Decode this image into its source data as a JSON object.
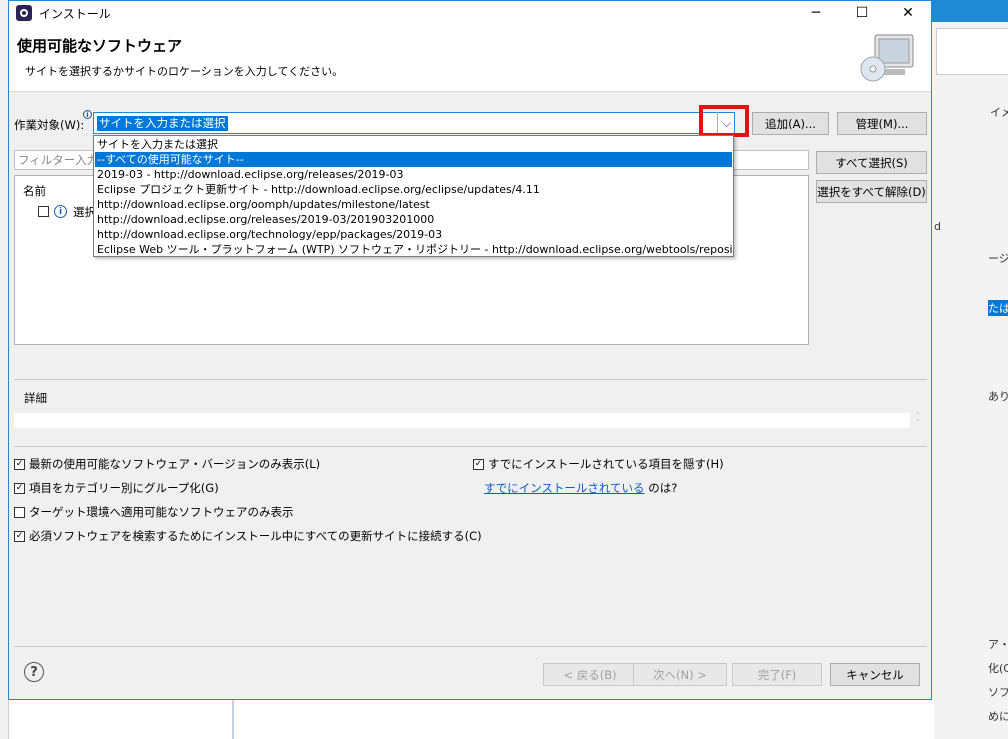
{
  "window": {
    "title": "インストール",
    "minimize": "─",
    "maximize": "☐",
    "close": "✕"
  },
  "header": {
    "title": "使用可能なソフトウェア",
    "description": "サイトを選択するかサイトのロケーションを入力してください。"
  },
  "work_with": {
    "label": "作業対象(W):",
    "value": "サイトを入力または選択",
    "add_button": "追加(A)...",
    "manage_button": "管理(M)..."
  },
  "dropdown": {
    "items": [
      "サイトを入力または選択",
      "--すべての使用可能なサイト--",
      "2019-03 - http://download.eclipse.org/releases/2019-03",
      "Eclipse プロジェクト更新サイト - http://download.eclipse.org/eclipse/updates/4.11",
      "http://download.eclipse.org/oomph/updates/milestone/latest",
      "http://download.eclipse.org/releases/2019-03/201903201000",
      "http://download.eclipse.org/technology/epp/packages/2019-03",
      "Eclipse Web ツール・プラットフォーム (WTP) ソフトウェア・リポジトリー - http://download.eclipse.org/webtools/repository/latest"
    ],
    "selected_index": 1
  },
  "filter": {
    "placeholder": "フィルター入力"
  },
  "tree": {
    "column": "名前",
    "row_text": "選択"
  },
  "side_buttons": {
    "select_all": "すべて選択(S)",
    "deselect_all": "選択をすべて解除(D)"
  },
  "details": {
    "label": "詳細"
  },
  "options": {
    "latest_only": "最新の使用可能なソフトウェア・バージョンのみ表示(L)",
    "group_by_category": "項目をカテゴリー別にグループ化(G)",
    "target_env_only": "ターゲット環境へ適用可能なソフトウェアのみ表示",
    "contact_all_sites": "必須ソフトウェアを検索するためにインストール中にすべての更新サイトに接続する(C)",
    "hide_installed": "すでにインストールされている項目を隠す(H)",
    "installed_link": "すでにインストールされている",
    "installed_suffix": " のは?"
  },
  "footer": {
    "back": "< 戻る(B)",
    "next": "次へ(N) >",
    "finish": "完了(F)",
    "cancel": "キャンセル"
  },
  "background": {
    "r1": "イメ",
    "r2": "d",
    "r3": "ージ",
    "r4": "たは",
    "r5": "ありま",
    "r6": "ア・パ",
    "r7": "化(G",
    "r8": "ソフト",
    "r9": "めに"
  }
}
